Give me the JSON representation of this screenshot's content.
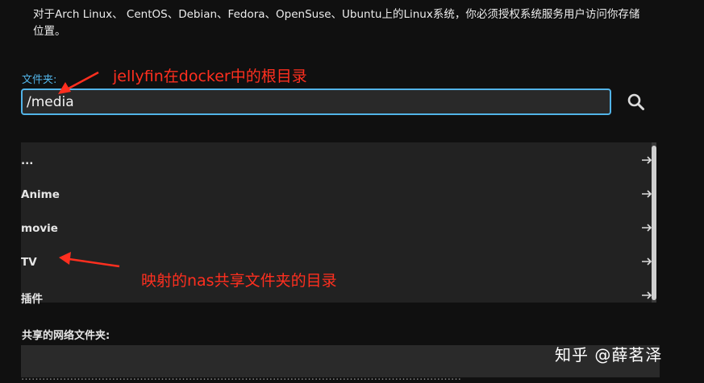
{
  "note": "对于Arch Linux、 CentOS、Debian、Fedora、OpenSuse、Ubuntu上的Linux系统，你必须授权系统服务用户访问你存储位置。",
  "folder_field": {
    "label": "文件夹:",
    "value": "/media"
  },
  "search_icon": "search-icon",
  "folders": [
    {
      "label": "..."
    },
    {
      "label": "Anime"
    },
    {
      "label": "movie"
    },
    {
      "label": "TV"
    },
    {
      "label": "插件"
    }
  ],
  "row_arrow_icon": "arrow-right-icon",
  "network_share": {
    "label": "共享的网络文件夹:",
    "value": ""
  },
  "annotations": {
    "root_dir": "jellyfin在docker中的根目录",
    "nas_dir": "映射的nas共享文件夹的目录"
  },
  "watermark": "知乎 @薛茗泽",
  "colors": {
    "accent": "#52b4e8",
    "annotation": "#ff2f1f",
    "background": "#101010",
    "list_bg": "#222222"
  }
}
